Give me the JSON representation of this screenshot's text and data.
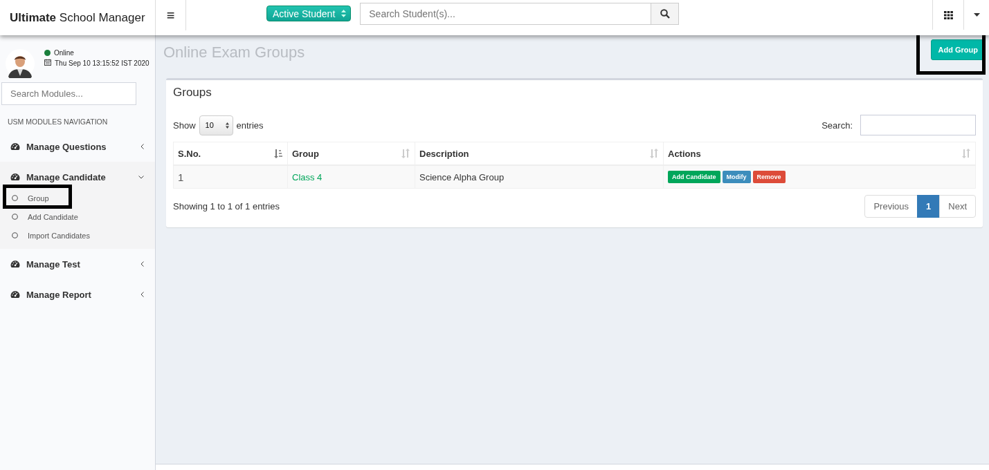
{
  "header": {
    "logo": "**Ultimate** School Manager",
    "menu_toggle": "≡",
    "status_select": "Active Student",
    "search": {
      "placeholder": "Search Student(s)..."
    }
  },
  "user": {
    "status": "Online",
    "datetime": "Thu Sep 10 13:15:52 IST 2020"
  },
  "sidebar": {
    "search": {
      "placeholder": "Search Modules..."
    },
    "heading": "USM MODULES NAVIGATION",
    "items": [
      {
        "label": "Manage Questions",
        "expanded": false
      },
      {
        "label": "Manage Candidate",
        "expanded": true,
        "children": [
          {
            "label": "Group",
            "highlighted": true
          },
          {
            "label": "Add Candidate",
            "highlighted": false
          },
          {
            "label": "Import Candidates",
            "highlighted": false
          }
        ]
      },
      {
        "label": "Manage Test",
        "expanded": false
      },
      {
        "label": "Manage Report",
        "expanded": false
      }
    ]
  },
  "page": {
    "title": "Online Exam Groups",
    "add_button": {
      "label": "Add Group",
      "highlighted": true
    }
  },
  "card": {
    "title": "Groups",
    "length_label_before": "Show",
    "length_value": "10",
    "length_label_after": "entries",
    "search_label": "Search:",
    "table": {
      "columns": [
        {
          "label": "S.No.",
          "sorted": true
        },
        {
          "label": "Group",
          "sorted": false
        },
        {
          "label": "Description",
          "sorted": false
        },
        {
          "label": "Actions",
          "sorted": false
        }
      ],
      "rows": [
        {
          "sno": "1",
          "group": "Class 4",
          "description": "Science Alpha Group",
          "actions": [
            {
              "label": "Add Candidate",
              "color": "#00a65a"
            },
            {
              "label": "Modify",
              "color": "#3c8dbc"
            },
            {
              "label": "Remove",
              "color": "#dd4b39"
            }
          ]
        }
      ]
    },
    "info": "Showing 1 to 1 of 1 entries",
    "pagination": [
      {
        "label": "Previous",
        "selected": false
      },
      {
        "label": "1",
        "selected": true
      },
      {
        "label": "Next",
        "selected": false
      }
    ]
  }
}
